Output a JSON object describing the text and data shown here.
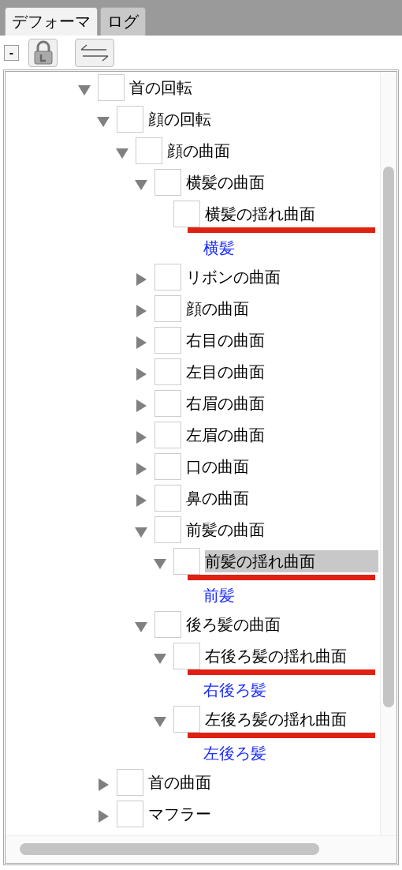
{
  "tabs": [
    {
      "label": "デフォーマ",
      "selected": true
    },
    {
      "label": "ログ",
      "selected": false
    }
  ],
  "toolbar": {
    "collapse_button": "-"
  },
  "tree": [
    {
      "label": "首の回転",
      "expanded": true,
      "children": [
        {
          "label": "顔の回転",
          "expanded": true,
          "children": [
            {
              "label": "顔の曲面",
              "expanded": true,
              "children": [
                {
                  "label": "横髪の曲面",
                  "expanded": true,
                  "children": [
                    {
                      "label": "横髪の揺れ曲面",
                      "underlined": true,
                      "selected": false,
                      "link": "横髪"
                    }
                  ]
                },
                {
                  "label": "リボンの曲面",
                  "expanded": false
                },
                {
                  "label": "顔の曲面",
                  "expanded": false
                },
                {
                  "label": "右目の曲面",
                  "expanded": false
                },
                {
                  "label": "左目の曲面",
                  "expanded": false
                },
                {
                  "label": "右眉の曲面",
                  "expanded": false
                },
                {
                  "label": "左眉の曲面",
                  "expanded": false
                },
                {
                  "label": "口の曲面",
                  "expanded": false
                },
                {
                  "label": "鼻の曲面",
                  "expanded": false
                },
                {
                  "label": "前髪の曲面",
                  "expanded": true,
                  "children": [
                    {
                      "label": "前髪の揺れ曲面",
                      "expanded": true,
                      "underlined": true,
                      "selected": true,
                      "link": "前髪"
                    }
                  ]
                },
                {
                  "label": "後ろ髪の曲面",
                  "expanded": true,
                  "children": [
                    {
                      "label": "右後ろ髪の揺れ曲面",
                      "expanded": true,
                      "underlined": true,
                      "selected": false,
                      "link": "右後ろ髪"
                    },
                    {
                      "label": "左後ろ髪の揺れ曲面",
                      "expanded": true,
                      "underlined": true,
                      "selected": false,
                      "link": "左後ろ髪"
                    }
                  ]
                }
              ]
            }
          ]
        },
        {
          "label": "首の曲面",
          "expanded": false
        },
        {
          "label": "マフラー",
          "expanded": false
        }
      ]
    }
  ]
}
